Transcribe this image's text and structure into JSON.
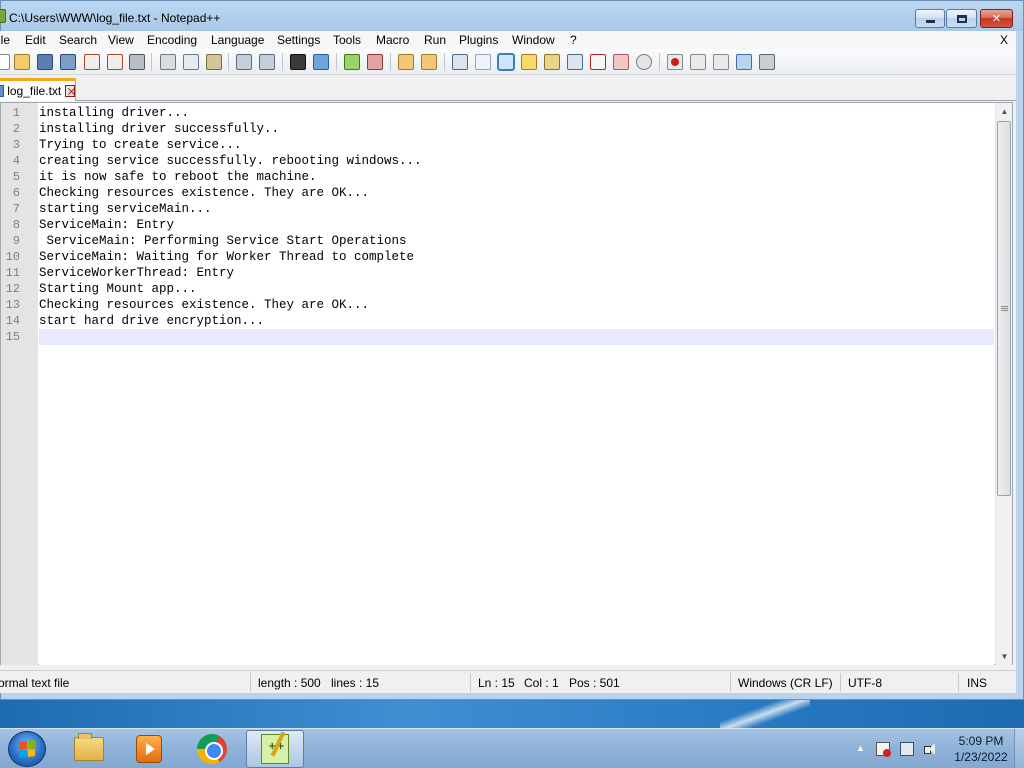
{
  "window": {
    "title": "C:\\Users\\WWW\\log_file.txt - Notepad++",
    "close_glyph": "✕"
  },
  "menu": {
    "items": [
      "ile",
      "Edit",
      "Search",
      "View",
      "Encoding",
      "Language",
      "Settings",
      "Tools",
      "Macro",
      "Run",
      "Plugins",
      "Window",
      "?"
    ],
    "close_label": "X"
  },
  "toolbar": {
    "icons": [
      "new-file-icon",
      "open-file-icon",
      "save-icon",
      "save-all-icon",
      "close-icon",
      "close-all-icon",
      "print-icon",
      "cut-icon",
      "copy-icon",
      "paste-icon",
      "undo-icon",
      "redo-icon",
      "find-icon",
      "replace-icon",
      "zoom-in-icon",
      "zoom-out-icon",
      "sync-vertical-icon",
      "sync-horizontal-icon",
      "word-wrap-icon",
      "show-all-characters-icon",
      "indent-guide-icon",
      "document-map-icon",
      "function-list-icon",
      "folder-as-workspace-icon",
      "doc-switcher-icon",
      "open-folder-icon",
      "monitoring-icon",
      "record-macro-icon",
      "stop-recording-icon",
      "play-macro-icon",
      "run-macro-multiple-icon",
      "save-macro-icon"
    ]
  },
  "tab": {
    "label": "log_file.txt"
  },
  "editor": {
    "line_numbers": [
      "1",
      "2",
      "3",
      "4",
      "5",
      "6",
      "7",
      "8",
      "9",
      "10",
      "11",
      "12",
      "13",
      "14",
      "15"
    ],
    "lines": [
      "installing driver...",
      "installing driver successfully..",
      "Trying to create service...",
      "creating service successfully. rebooting windows...",
      "it is now safe to reboot the machine.",
      "Checking resources existence. They are OK...",
      "starting serviceMain...",
      "ServiceMain: Entry",
      " ServiceMain: Performing Service Start Operations",
      "ServiceMain: Waiting for Worker Thread to complete",
      "ServiceWorkerThread: Entry",
      "Starting Mount app...",
      "Checking resources existence. They are OK...",
      "start hard drive encryption...",
      ""
    ],
    "current_line": 15
  },
  "statusbar": {
    "file_type": "ormal text file",
    "length": "length : 500",
    "lines": "lines : 15",
    "ln": "Ln : 15",
    "col": "Col : 1",
    "pos": "Pos : 501",
    "eol": "Windows (CR LF)",
    "encoding": "UTF-8",
    "mode": "INS"
  },
  "taskbar": {
    "apps": [
      "windows-explorer-icon",
      "media-player-icon",
      "chrome-icon",
      "notepad-plus-plus-icon"
    ],
    "active_app": "notepad-plus-plus-icon",
    "time": "5:09 PM",
    "date": "1/23/2022",
    "tray_arrow": "▲"
  },
  "colors": {
    "tab_accent": "#f7a71c",
    "current_line": "#e8e8ff",
    "gutter": "#e4e4e4",
    "close_button": "#c4361f"
  }
}
